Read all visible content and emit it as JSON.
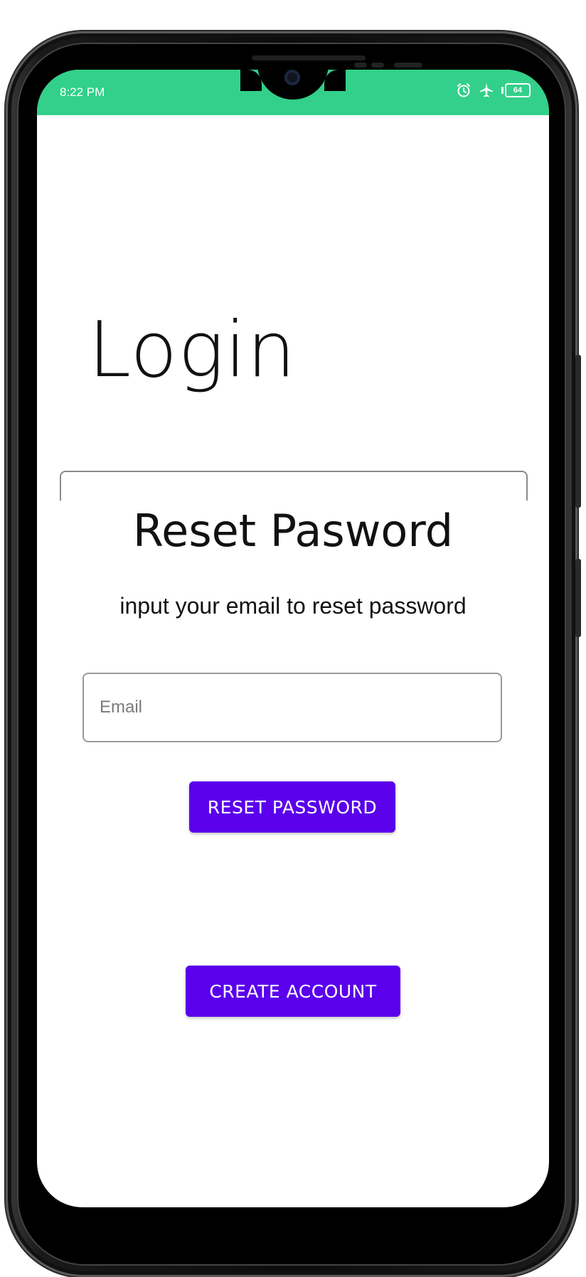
{
  "status_bar": {
    "time": "8:22 PM",
    "battery_level": "64",
    "icons": [
      "alarm-icon",
      "airplane-mode-icon",
      "battery-icon"
    ],
    "color": "#32d08a"
  },
  "app": {
    "title": "Login",
    "reset_card": {
      "title": "Reset Pasword",
      "subtitle": "input your email to reset password",
      "email_placeholder": "Email",
      "email_value": "",
      "reset_button_label": "RESET PASSWORD"
    },
    "create_account_label": "CREATE ACCOUNT",
    "accent_color": "#5a00ec"
  }
}
